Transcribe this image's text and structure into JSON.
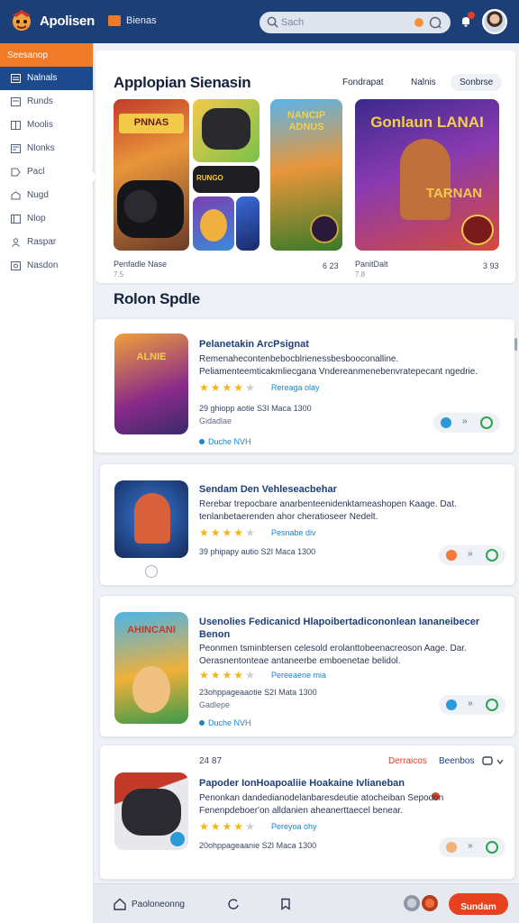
{
  "app": {
    "title": "Apolisen"
  },
  "header": {
    "nav_link": "Bienas",
    "search": {
      "placeholder": "Sach"
    },
    "icons": [
      "logo-icon",
      "search-icon",
      "clear-icon",
      "bell-icon",
      "avatar"
    ]
  },
  "sidebar": {
    "header": "Seesanop",
    "items": [
      {
        "label": "Nalnals",
        "active": true
      },
      {
        "label": "Runds"
      },
      {
        "label": "Moolis"
      },
      {
        "label": "Nlonks"
      },
      {
        "label": "Pacl"
      },
      {
        "label": "Nugd"
      },
      {
        "label": "Nlop"
      },
      {
        "label": "Raspar"
      },
      {
        "label": "Nasdon"
      }
    ]
  },
  "featured": {
    "title": "Applopian Sienasin",
    "tabs": [
      "Fondrapat",
      "Nalnis",
      "Sonbrse"
    ],
    "tile1": {
      "caption": "Penfadle Nase",
      "sub": "7.5",
      "num": "6 23"
    },
    "tile2": {
      "caption": "PanitDalt",
      "sub": "7.8",
      "num": "3 93"
    },
    "tile_texts": {
      "t1": "PNNAS",
      "t2": "RUNGO",
      "t3": "NANCIP ADNUS",
      "t4": "Gonlaun LANAI",
      "t5": "TARNAN"
    }
  },
  "recommended": {
    "title": "Rolon Spdle",
    "items": [
      {
        "title": "Pelanetakin ArcPsignat",
        "desc": "Remenahecontenbebocblrienessbesbooconalline. Peliamenteemticakmliecgana Vndereanmenebenvratepecant ngedrie.",
        "rating": 4,
        "rating_link": "Rereaga olay",
        "meta": "29 ghiopp aotie   S3I Maca 1300",
        "meta2": "Gidadlae",
        "tag": "Duche   NVH",
        "thumb_text": "ALNIE"
      },
      {
        "title": "Sendam Den Vehleseacbehar",
        "desc": "Rerebar trepocbare anarbenteenidenktameashopen Kaage. Dat. tenlanbetaerenden ahor cheratioseer Nedelt.",
        "rating": 4,
        "rating_link": "Pesnabe div",
        "meta": "39 phipapy autio   S2I Maca 1300",
        "meta2": "",
        "tag": "",
        "thumb_text": ""
      },
      {
        "title": "Usenolies Fedicanicd Hlapoibertadicononlean Iananeibecer Benon",
        "desc": "Peonmen tsminbtersen celesold erolanttobeenacreoson Aage. Dar. Oerasnentonteae antaneerbe emboenetae belidol.",
        "rating": 4,
        "rating_link": "Pereeaene mia",
        "meta": "23ohppageaaotie   S2I Mata 1300",
        "meta2": "Gadlepe",
        "tag": "Duche   NVH",
        "thumb_text": "AHINCANI"
      },
      {
        "title": "Papoder IonHoapoaliie Hoakaine Ivlianeban",
        "desc": "Penonkan dandedianodelanbaresdeutie atocheiban Sepodon Fenenpdeboer'on alldanien aheanerttaecel benear.",
        "rating": 4,
        "rating_link": "Pereyoa ohy",
        "meta": "20ohppageaanie   S2I Maca 1300",
        "meta2": "",
        "tag": "",
        "thumb_text": "",
        "top_links": [
          "24   87",
          "Derraicos",
          "Beenbos"
        ]
      }
    ]
  },
  "bottom": {
    "label": "Paoloneonng",
    "cta": "Sundam"
  },
  "colors": {
    "primary": "#1d3f78",
    "accent": "#f07a26",
    "cta": "#e8411f",
    "link": "#1a86c8",
    "star": "#f4b41a"
  }
}
